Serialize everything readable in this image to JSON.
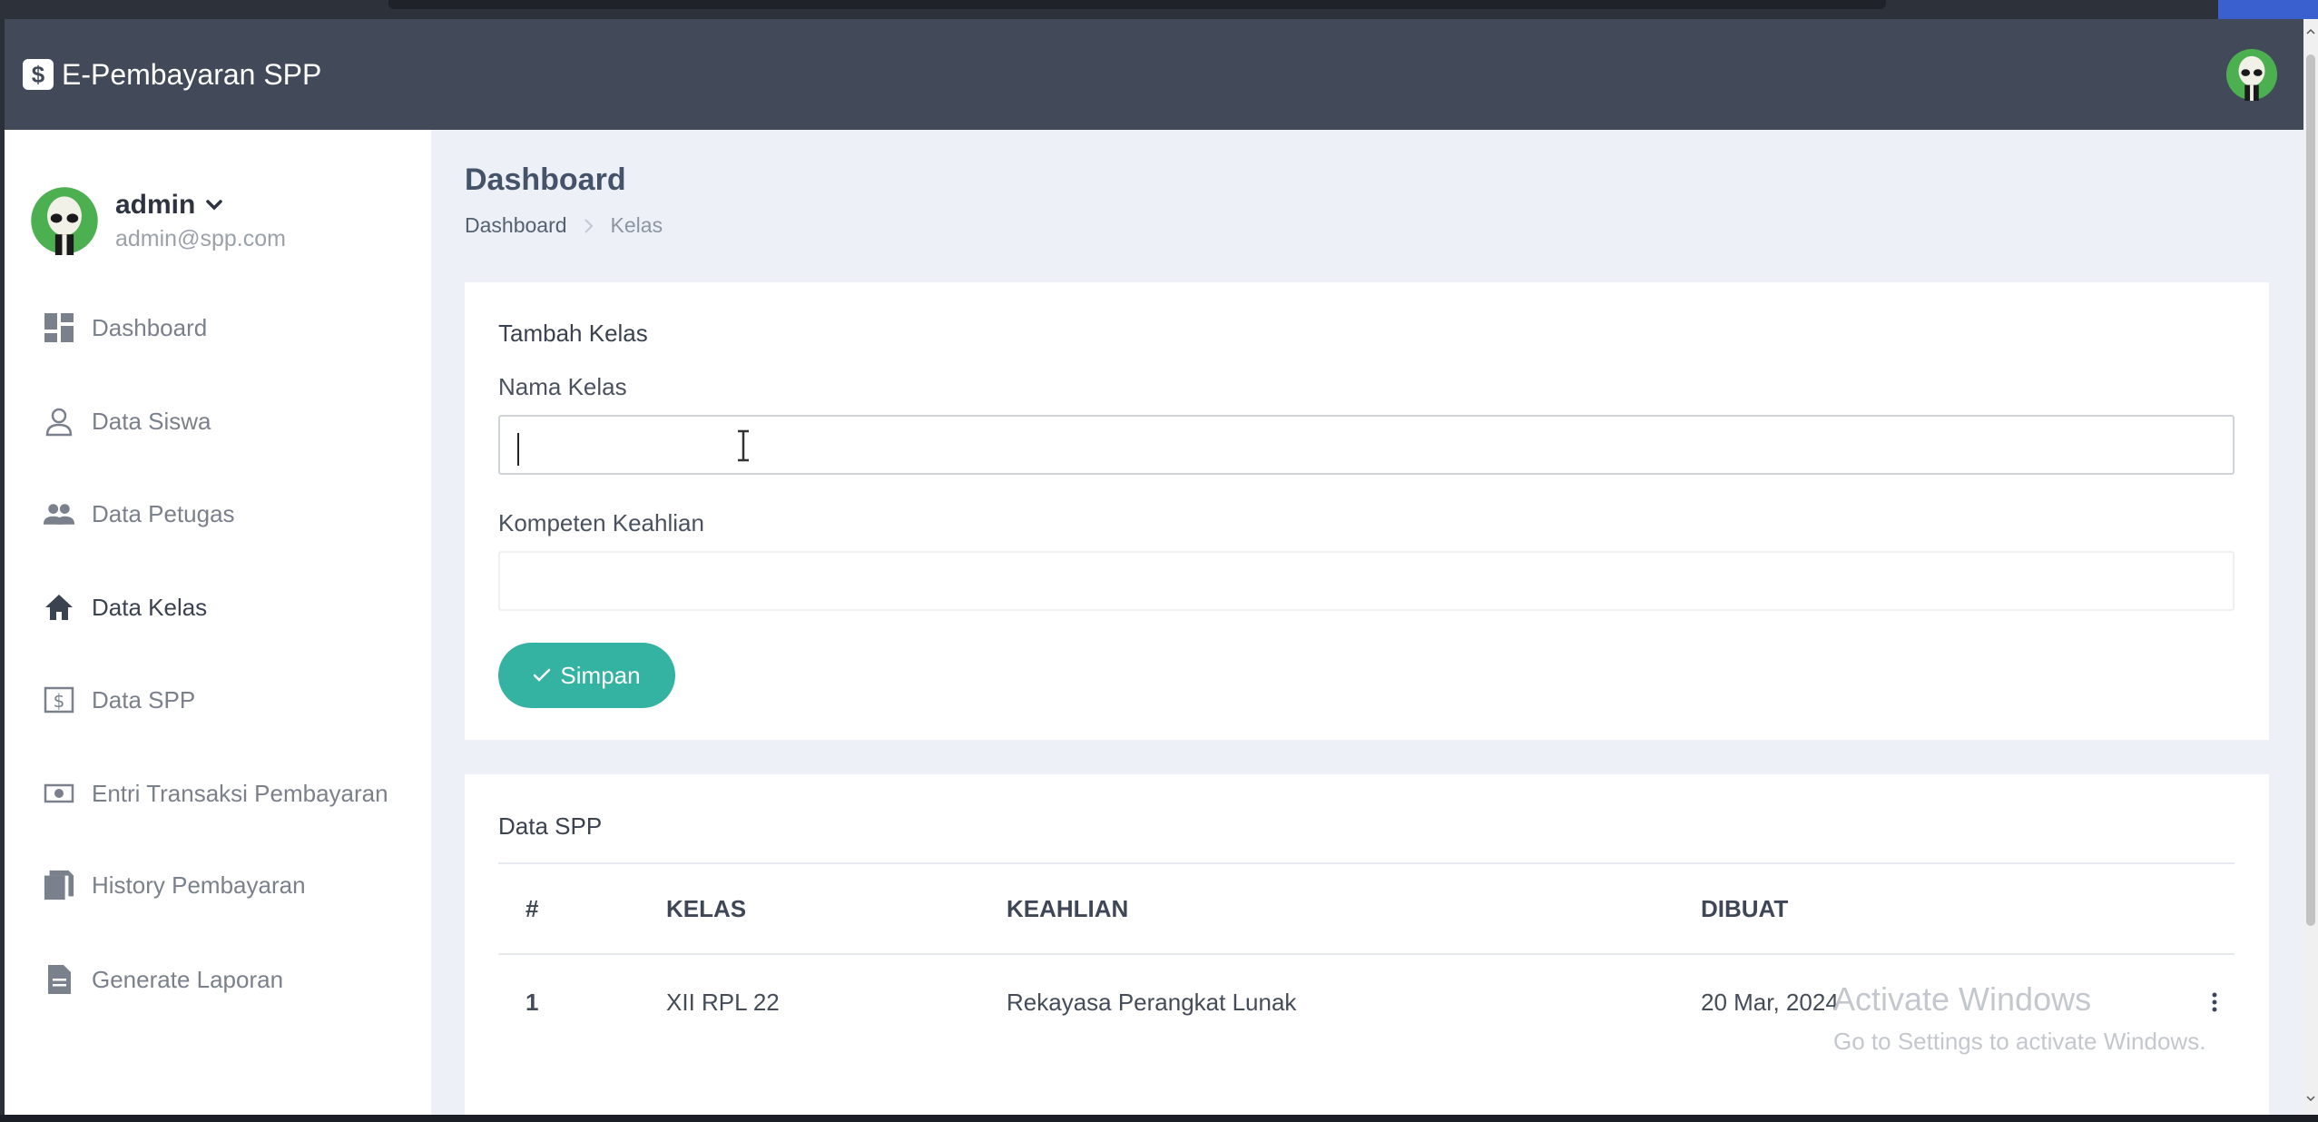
{
  "navbar": {
    "brand_icon": "$",
    "brand_title": "E-Pembayaran SPP",
    "avatar_icon": "alien-avatar-icon"
  },
  "sidebar": {
    "user": {
      "name": "admin",
      "email": "admin@spp.com"
    },
    "items": [
      {
        "label": "Dashboard",
        "icon": "dashboard-icon"
      },
      {
        "label": "Data Siswa",
        "icon": "user-icon"
      },
      {
        "label": "Data Petugas",
        "icon": "users-icon"
      },
      {
        "label": "Data Kelas",
        "icon": "home-icon",
        "active": true
      },
      {
        "label": "Data SPP",
        "icon": "dollar-icon"
      },
      {
        "label": "Entri Transaksi Pembayaran",
        "icon": "money-icon"
      },
      {
        "label": "History Pembayaran",
        "icon": "documents-icon"
      },
      {
        "label": "Generate Laporan",
        "icon": "file-icon"
      }
    ]
  },
  "page": {
    "title": "Dashboard",
    "breadcrumb": [
      "Dashboard",
      "Kelas"
    ]
  },
  "form": {
    "title": "Tambah Kelas",
    "nama_label": "Nama Kelas",
    "nama_value": "",
    "kompeten_label": "Kompeten Keahlian",
    "kompeten_value": "",
    "submit_label": "Simpan"
  },
  "table": {
    "title": "Data SPP",
    "headers": [
      "#",
      "KELAS",
      "KEAHLIAN",
      "DIBUAT"
    ],
    "rows": [
      [
        "1",
        "XII RPL 22",
        "Rekayasa Perangkat Lunak",
        "20 Mar, 2024"
      ]
    ]
  },
  "watermark": {
    "line1": "Activate Windows",
    "line2": "Go to Settings to activate Windows."
  },
  "colors": {
    "navbar": "#424a59",
    "accent": "#35b3a2",
    "content_bg": "#edf1f7"
  }
}
